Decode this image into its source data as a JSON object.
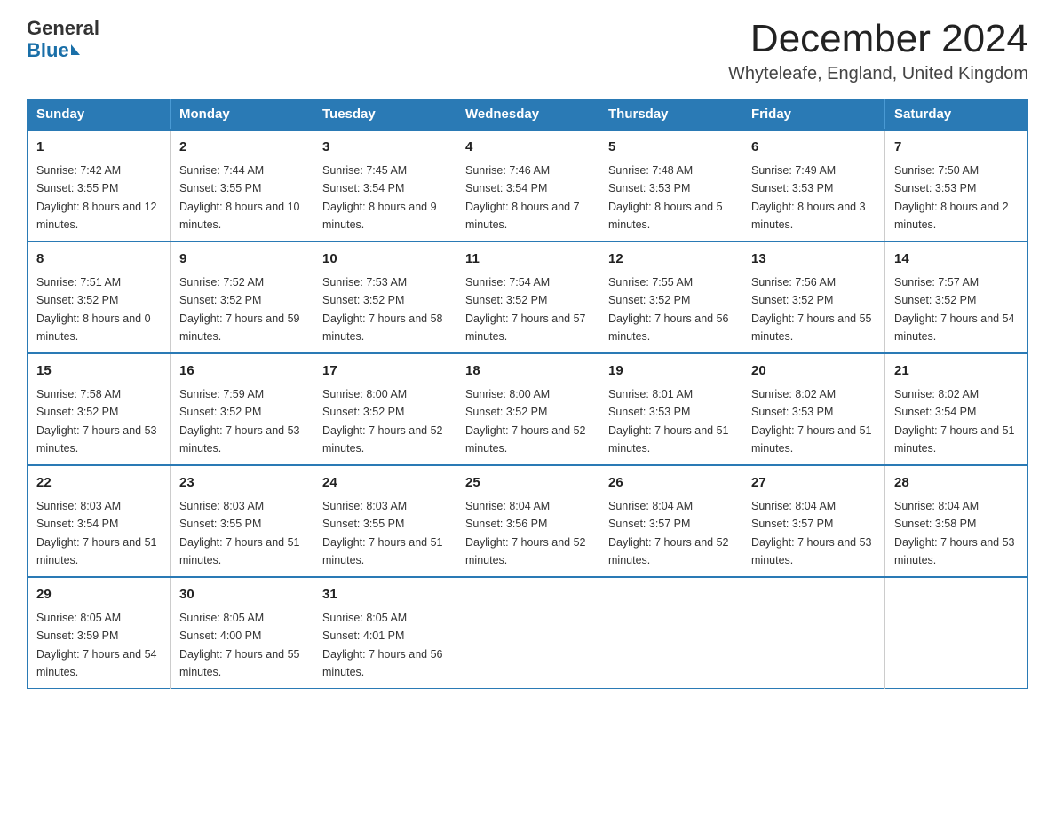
{
  "logo": {
    "general": "General",
    "blue": "Blue"
  },
  "title": "December 2024",
  "location": "Whyteleafe, England, United Kingdom",
  "days_of_week": [
    "Sunday",
    "Monday",
    "Tuesday",
    "Wednesday",
    "Thursday",
    "Friday",
    "Saturday"
  ],
  "weeks": [
    [
      {
        "day": 1,
        "sunrise": "7:42 AM",
        "sunset": "3:55 PM",
        "daylight": "8 hours and 12 minutes."
      },
      {
        "day": 2,
        "sunrise": "7:44 AM",
        "sunset": "3:55 PM",
        "daylight": "8 hours and 10 minutes."
      },
      {
        "day": 3,
        "sunrise": "7:45 AM",
        "sunset": "3:54 PM",
        "daylight": "8 hours and 9 minutes."
      },
      {
        "day": 4,
        "sunrise": "7:46 AM",
        "sunset": "3:54 PM",
        "daylight": "8 hours and 7 minutes."
      },
      {
        "day": 5,
        "sunrise": "7:48 AM",
        "sunset": "3:53 PM",
        "daylight": "8 hours and 5 minutes."
      },
      {
        "day": 6,
        "sunrise": "7:49 AM",
        "sunset": "3:53 PM",
        "daylight": "8 hours and 3 minutes."
      },
      {
        "day": 7,
        "sunrise": "7:50 AM",
        "sunset": "3:53 PM",
        "daylight": "8 hours and 2 minutes."
      }
    ],
    [
      {
        "day": 8,
        "sunrise": "7:51 AM",
        "sunset": "3:52 PM",
        "daylight": "8 hours and 0 minutes."
      },
      {
        "day": 9,
        "sunrise": "7:52 AM",
        "sunset": "3:52 PM",
        "daylight": "7 hours and 59 minutes."
      },
      {
        "day": 10,
        "sunrise": "7:53 AM",
        "sunset": "3:52 PM",
        "daylight": "7 hours and 58 minutes."
      },
      {
        "day": 11,
        "sunrise": "7:54 AM",
        "sunset": "3:52 PM",
        "daylight": "7 hours and 57 minutes."
      },
      {
        "day": 12,
        "sunrise": "7:55 AM",
        "sunset": "3:52 PM",
        "daylight": "7 hours and 56 minutes."
      },
      {
        "day": 13,
        "sunrise": "7:56 AM",
        "sunset": "3:52 PM",
        "daylight": "7 hours and 55 minutes."
      },
      {
        "day": 14,
        "sunrise": "7:57 AM",
        "sunset": "3:52 PM",
        "daylight": "7 hours and 54 minutes."
      }
    ],
    [
      {
        "day": 15,
        "sunrise": "7:58 AM",
        "sunset": "3:52 PM",
        "daylight": "7 hours and 53 minutes."
      },
      {
        "day": 16,
        "sunrise": "7:59 AM",
        "sunset": "3:52 PM",
        "daylight": "7 hours and 53 minutes."
      },
      {
        "day": 17,
        "sunrise": "8:00 AM",
        "sunset": "3:52 PM",
        "daylight": "7 hours and 52 minutes."
      },
      {
        "day": 18,
        "sunrise": "8:00 AM",
        "sunset": "3:52 PM",
        "daylight": "7 hours and 52 minutes."
      },
      {
        "day": 19,
        "sunrise": "8:01 AM",
        "sunset": "3:53 PM",
        "daylight": "7 hours and 51 minutes."
      },
      {
        "day": 20,
        "sunrise": "8:02 AM",
        "sunset": "3:53 PM",
        "daylight": "7 hours and 51 minutes."
      },
      {
        "day": 21,
        "sunrise": "8:02 AM",
        "sunset": "3:54 PM",
        "daylight": "7 hours and 51 minutes."
      }
    ],
    [
      {
        "day": 22,
        "sunrise": "8:03 AM",
        "sunset": "3:54 PM",
        "daylight": "7 hours and 51 minutes."
      },
      {
        "day": 23,
        "sunrise": "8:03 AM",
        "sunset": "3:55 PM",
        "daylight": "7 hours and 51 minutes."
      },
      {
        "day": 24,
        "sunrise": "8:03 AM",
        "sunset": "3:55 PM",
        "daylight": "7 hours and 51 minutes."
      },
      {
        "day": 25,
        "sunrise": "8:04 AM",
        "sunset": "3:56 PM",
        "daylight": "7 hours and 52 minutes."
      },
      {
        "day": 26,
        "sunrise": "8:04 AM",
        "sunset": "3:57 PM",
        "daylight": "7 hours and 52 minutes."
      },
      {
        "day": 27,
        "sunrise": "8:04 AM",
        "sunset": "3:57 PM",
        "daylight": "7 hours and 53 minutes."
      },
      {
        "day": 28,
        "sunrise": "8:04 AM",
        "sunset": "3:58 PM",
        "daylight": "7 hours and 53 minutes."
      }
    ],
    [
      {
        "day": 29,
        "sunrise": "8:05 AM",
        "sunset": "3:59 PM",
        "daylight": "7 hours and 54 minutes."
      },
      {
        "day": 30,
        "sunrise": "8:05 AM",
        "sunset": "4:00 PM",
        "daylight": "7 hours and 55 minutes."
      },
      {
        "day": 31,
        "sunrise": "8:05 AM",
        "sunset": "4:01 PM",
        "daylight": "7 hours and 56 minutes."
      },
      null,
      null,
      null,
      null
    ]
  ]
}
